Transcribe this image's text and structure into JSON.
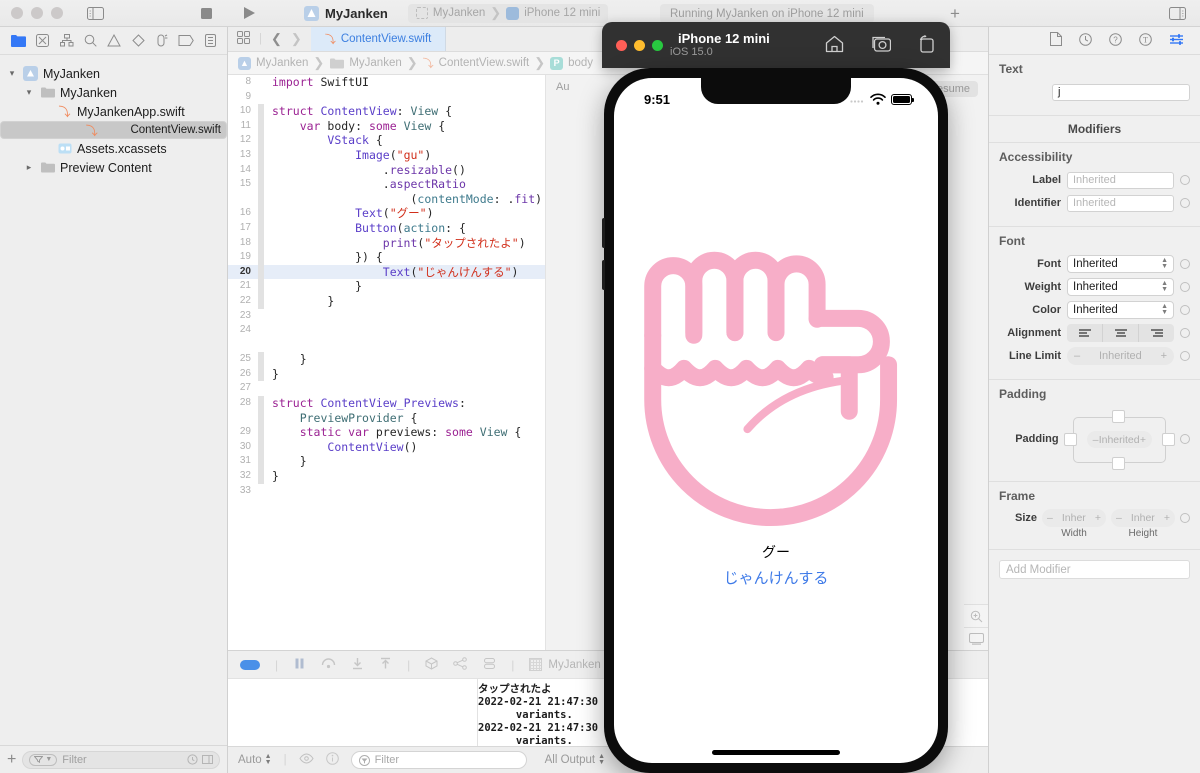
{
  "window": {
    "app_title": "MyJanken",
    "scheme": "MyJanken",
    "destination": "iPhone 12 mini",
    "run_status": "Running MyJanken on iPhone 12 mini",
    "add_label": "+"
  },
  "navigator": {
    "tabs": [
      {
        "name": "folder-icon",
        "active": true
      },
      {
        "name": "source-control-icon",
        "active": false
      },
      {
        "name": "symbol-hierarchy-icon",
        "active": false
      },
      {
        "name": "search-icon",
        "active": false
      },
      {
        "name": "warning-icon",
        "active": false
      },
      {
        "name": "test-icon",
        "active": false
      },
      {
        "name": "debug-gauge-icon",
        "active": false
      },
      {
        "name": "breakpoint-icon",
        "active": false
      },
      {
        "name": "report-icon",
        "active": false
      }
    ],
    "tree": [
      {
        "label": "MyJanken",
        "indent": 0,
        "twisty": "v",
        "icon": "project",
        "selected": false
      },
      {
        "label": "MyJanken",
        "indent": 1,
        "twisty": "v",
        "icon": "folder",
        "selected": false
      },
      {
        "label": "MyJankenApp.swift",
        "indent": 2,
        "twisty": "",
        "icon": "swift",
        "selected": false
      },
      {
        "label": "ContentView.swift",
        "indent": 2,
        "twisty": "",
        "icon": "swift",
        "selected": true
      },
      {
        "label": "Assets.xcassets",
        "indent": 2,
        "twisty": "",
        "icon": "assets",
        "selected": false
      },
      {
        "label": "Preview Content",
        "indent": 1,
        "twisty": ">",
        "icon": "folder",
        "selected": false
      }
    ],
    "filter_placeholder": "Filter"
  },
  "editor": {
    "tab_label": "ContentView.swift",
    "breadcrumb": [
      "MyJanken",
      "MyJanken",
      "ContentView.swift",
      "body"
    ],
    "lines": [
      {
        "num": "8",
        "indent": 0,
        "text": "import SwiftUI",
        "tokens": [
          [
            "kw",
            "import"
          ],
          [
            "pl",
            " SwiftUI"
          ]
        ],
        "fold": false,
        "hl": false
      },
      {
        "num": "9",
        "indent": 0,
        "text": "",
        "tokens": [],
        "fold": false,
        "hl": false
      },
      {
        "num": "10",
        "indent": 0,
        "text": "struct ContentView: View {",
        "tokens": [
          [
            "kw",
            "struct"
          ],
          [
            "pl",
            " "
          ],
          [
            "tyb",
            "ContentView"
          ],
          [
            "pl",
            ": "
          ],
          [
            "ty",
            "View"
          ],
          [
            "pl",
            " {"
          ]
        ],
        "fold": true,
        "hl": false
      },
      {
        "num": "11",
        "indent": 1,
        "text": "var body: some View {",
        "tokens": [
          [
            "kw",
            "var"
          ],
          [
            "pl",
            " body: "
          ],
          [
            "kw",
            "some"
          ],
          [
            "pl",
            " "
          ],
          [
            "ty",
            "View"
          ],
          [
            "pl",
            " {"
          ]
        ],
        "fold": true,
        "hl": false
      },
      {
        "num": "12",
        "indent": 2,
        "text": "VStack {",
        "tokens": [
          [
            "tyb",
            "VStack"
          ],
          [
            "pl",
            " {"
          ]
        ],
        "fold": true,
        "hl": false
      },
      {
        "num": "13",
        "indent": 3,
        "text": "Image(\"gu\")",
        "tokens": [
          [
            "tyb",
            "Image"
          ],
          [
            "pl",
            "("
          ],
          [
            "str",
            "\"gu\""
          ],
          [
            "pl",
            ")"
          ]
        ],
        "fold": true,
        "hl": false
      },
      {
        "num": "14",
        "indent": 4,
        "text": ".resizable()",
        "tokens": [
          [
            "pl",
            "."
          ],
          [
            "fn",
            "resizable"
          ],
          [
            "pl",
            "()"
          ]
        ],
        "fold": true,
        "hl": false
      },
      {
        "num": "15",
        "indent": 4,
        "text": ".aspectRatio",
        "tokens": [
          [
            "pl",
            "."
          ],
          [
            "fn",
            "aspectRatio"
          ]
        ],
        "fold": true,
        "hl": false
      },
      {
        "num": "",
        "indent": 5,
        "text": "(contentMode: .fit)",
        "tokens": [
          [
            "pl",
            "("
          ],
          [
            "prop",
            "contentMode"
          ],
          [
            "pl",
            ": ."
          ],
          [
            "mem",
            "fit"
          ],
          [
            "pl",
            ")"
          ]
        ],
        "fold": true,
        "hl": false
      },
      {
        "num": "16",
        "indent": 3,
        "text": "Text(\"グー\")",
        "tokens": [
          [
            "tyb",
            "Text"
          ],
          [
            "pl",
            "("
          ],
          [
            "str",
            "\"グー\""
          ],
          [
            "pl",
            ")"
          ]
        ],
        "fold": true,
        "hl": false
      },
      {
        "num": "17",
        "indent": 3,
        "text": "Button(action: {",
        "tokens": [
          [
            "tyb",
            "Button"
          ],
          [
            "pl",
            "("
          ],
          [
            "prop",
            "action"
          ],
          [
            "pl",
            ": {"
          ]
        ],
        "fold": true,
        "hl": false
      },
      {
        "num": "18",
        "indent": 4,
        "text": "print(\"タップされたよ\")",
        "tokens": [
          [
            "fn",
            "print"
          ],
          [
            "pl",
            "("
          ],
          [
            "str",
            "\"タップされたよ\""
          ],
          [
            "pl",
            ")"
          ]
        ],
        "fold": true,
        "hl": false
      },
      {
        "num": "19",
        "indent": 3,
        "text": "}) {",
        "tokens": [
          [
            "pl",
            "}) {"
          ]
        ],
        "fold": true,
        "hl": false
      },
      {
        "num": "20",
        "indent": 4,
        "text": "Text(\"じゃんけんする\")",
        "tokens": [
          [
            "tyb",
            "Text"
          ],
          [
            "pl",
            "("
          ],
          [
            "str",
            "\"じゃんけんする\""
          ],
          [
            "pl",
            ")"
          ]
        ],
        "fold": true,
        "hl": true
      },
      {
        "num": "21",
        "indent": 3,
        "text": "}",
        "tokens": [
          [
            "pl",
            "}"
          ]
        ],
        "fold": true,
        "hl": false
      },
      {
        "num": "22",
        "indent": 2,
        "text": "}",
        "tokens": [
          [
            "pl",
            "}"
          ]
        ],
        "fold": true,
        "hl": false
      },
      {
        "num": "23",
        "indent": 0,
        "text": "",
        "tokens": [],
        "fold": false,
        "hl": false
      },
      {
        "num": "24",
        "indent": 0,
        "text": "",
        "tokens": [],
        "fold": false,
        "hl": false
      },
      {
        "num": "",
        "indent": 0,
        "text": "",
        "tokens": [],
        "fold": false,
        "hl": false
      },
      {
        "num": "25",
        "indent": 1,
        "text": "}",
        "tokens": [
          [
            "pl",
            "}"
          ]
        ],
        "fold": true,
        "hl": false
      },
      {
        "num": "26",
        "indent": 0,
        "text": "}",
        "tokens": [
          [
            "pl",
            "}"
          ]
        ],
        "fold": true,
        "hl": false
      },
      {
        "num": "27",
        "indent": 0,
        "text": "",
        "tokens": [],
        "fold": false,
        "hl": false
      },
      {
        "num": "28",
        "indent": 0,
        "text": "struct ContentView_Previews:",
        "tokens": [
          [
            "kw",
            "struct"
          ],
          [
            "pl",
            " "
          ],
          [
            "tyb",
            "ContentView_Previews"
          ],
          [
            "pl",
            ":"
          ]
        ],
        "fold": true,
        "hl": false
      },
      {
        "num": "",
        "indent": 1,
        "text": "PreviewProvider {",
        "tokens": [
          [
            "ty",
            "PreviewProvider"
          ],
          [
            "pl",
            " {"
          ]
        ],
        "fold": true,
        "hl": false
      },
      {
        "num": "29",
        "indent": 1,
        "text": "static var previews: some View {",
        "tokens": [
          [
            "kw",
            "static var"
          ],
          [
            "pl",
            " previews: "
          ],
          [
            "kw",
            "some"
          ],
          [
            "pl",
            " "
          ],
          [
            "ty",
            "View"
          ],
          [
            "pl",
            " {"
          ]
        ],
        "fold": true,
        "hl": false
      },
      {
        "num": "30",
        "indent": 2,
        "text": "ContentView()",
        "tokens": [
          [
            "tyb",
            "ContentView"
          ],
          [
            "pl",
            "()"
          ]
        ],
        "fold": true,
        "hl": false
      },
      {
        "num": "31",
        "indent": 1,
        "text": "}",
        "tokens": [
          [
            "pl",
            "}"
          ]
        ],
        "fold": true,
        "hl": false
      },
      {
        "num": "32",
        "indent": 0,
        "text": "}",
        "tokens": [
          [
            "pl",
            "}"
          ]
        ],
        "fold": true,
        "hl": false
      },
      {
        "num": "33",
        "indent": 0,
        "text": "",
        "tokens": [],
        "fold": false,
        "hl": false
      }
    ]
  },
  "canvas": {
    "auto_label": "Au",
    "resume_label": "Resume"
  },
  "debug": {
    "process_name": "MyJanken",
    "console_lines": [
      "タップされたよ",
      "2022-02-21 21:47:30",
      "      variants.",
      "2022-02-21 21:47:30",
      "      variants."
    ],
    "auto_label": "Auto",
    "filter_placeholder": "Filter",
    "output_scope": "All Output"
  },
  "inspector": {
    "tabs": [
      {
        "name": "file-inspector-icon",
        "active": false
      },
      {
        "name": "history-inspector-icon",
        "active": false
      },
      {
        "name": "quick-help-inspector-icon",
        "active": false
      },
      {
        "name": "accessibility-inspector-icon",
        "active": false
      },
      {
        "name": "attributes-inspector-icon",
        "active": true
      }
    ],
    "text_section": {
      "title": "Text",
      "value": "j"
    },
    "modifiers_title": "Modifiers",
    "accessibility": {
      "title": "Accessibility",
      "fields": [
        {
          "label": "Label",
          "placeholder": "Inherited"
        },
        {
          "label": "Identifier",
          "placeholder": "Inherited"
        }
      ]
    },
    "font": {
      "title": "Font",
      "font": {
        "label": "Font",
        "value": "Inherited"
      },
      "weight": {
        "label": "Weight",
        "value": "Inherited"
      },
      "color": {
        "label": "Color",
        "value": "Inherited"
      },
      "alignment": {
        "label": "Alignment",
        "options": [
          "align-left",
          "align-center",
          "align-right"
        ]
      },
      "line_limit": {
        "label": "Line Limit",
        "value": "Inherited",
        "minus": "–",
        "plus": "+"
      }
    },
    "padding": {
      "title": "Padding",
      "label": "Padding",
      "value": "Inherited",
      "minus": "–",
      "plus": "+"
    },
    "frame": {
      "title": "Frame",
      "label": "Size",
      "width": {
        "value": "Inher",
        "caption": "Width"
      },
      "height": {
        "value": "Inher",
        "caption": "Height"
      },
      "minus": "–",
      "plus": "+"
    },
    "add_modifier_placeholder": "Add Modifier"
  },
  "simulator": {
    "title": "iPhone 12 mini",
    "subtitle": "iOS 15.0",
    "dots": [
      "#ff5f57",
      "#febc2e",
      "#28c840"
    ],
    "icons": [
      "home-icon",
      "camera-icon",
      "rotate-icon"
    ],
    "status_time": "9:51",
    "app": {
      "image_name": "gu-fist-image",
      "label": "グー",
      "button": "じゃんけんする",
      "fist_color": "#f7aec8",
      "button_color": "#3e7ae8"
    }
  }
}
